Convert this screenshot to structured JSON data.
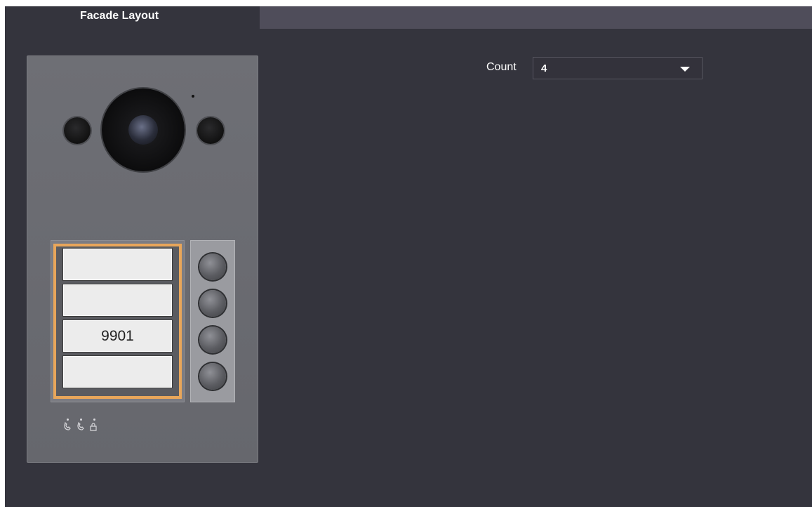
{
  "tabs": {
    "active_label": "Facade Layout"
  },
  "device": {
    "name_slots": [
      "",
      "",
      "9901",
      ""
    ],
    "call_buttons": 4,
    "indicator_icons": [
      "phone-icon",
      "phone-icon",
      "lock-icon"
    ]
  },
  "count": {
    "label": "Count",
    "value": "4"
  },
  "colors": {
    "background": "#34343d",
    "tab_bar": "#4f4d5a",
    "selection_frame": "#e8a65a"
  }
}
